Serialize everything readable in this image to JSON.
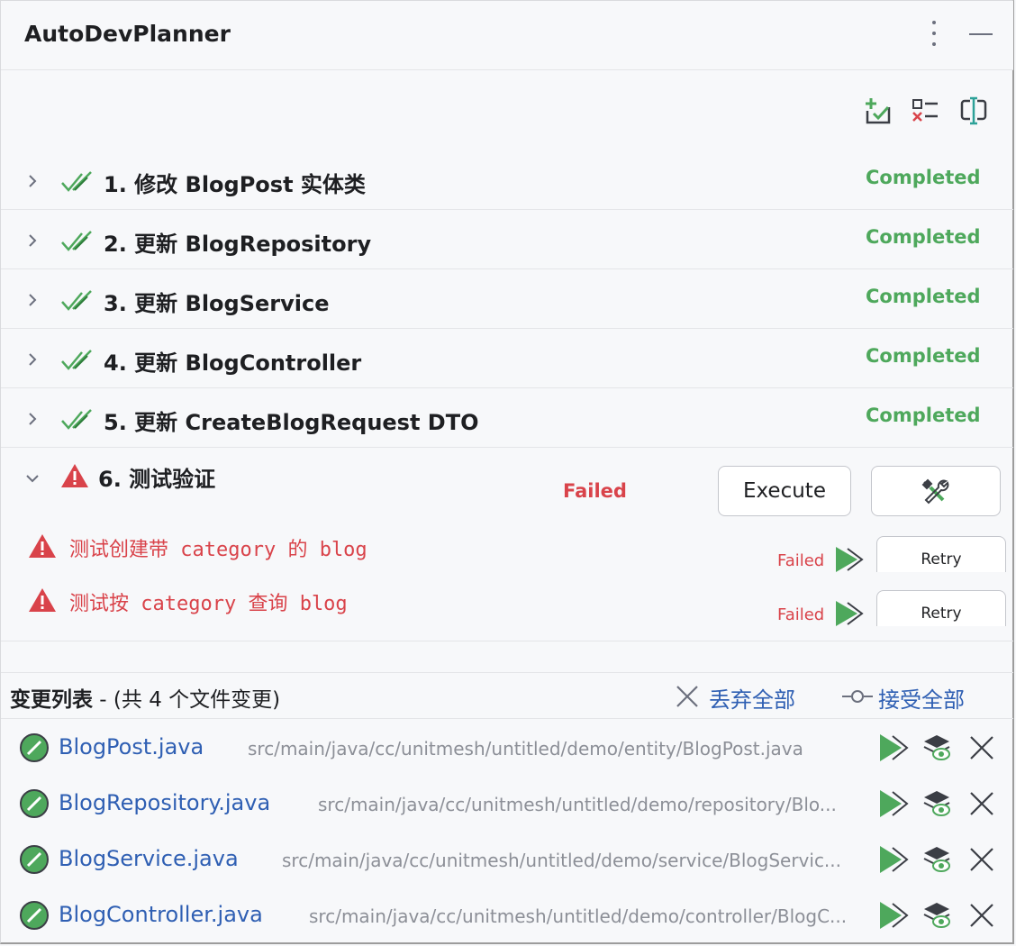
{
  "window": {
    "title": "AutoDevPlanner"
  },
  "toolbar": {
    "icons": [
      "add-task-icon",
      "checklist-icon",
      "text-cursor-icon"
    ]
  },
  "tasks": [
    {
      "title": "1. 修改 BlogPost 实体类",
      "status": "Completed"
    },
    {
      "title": "2. 更新 BlogRepository",
      "status": "Completed"
    },
    {
      "title": "3. 更新 BlogService",
      "status": "Completed"
    },
    {
      "title": "4. 更新 BlogController",
      "status": "Completed"
    },
    {
      "title": "5. 更新 CreateBlogRequest DTO",
      "status": "Completed"
    }
  ],
  "failed_task": {
    "title": "6. 测试验证",
    "status": "Failed",
    "execute_label": "Execute",
    "subtasks": [
      {
        "title": "测试创建带 category 的 blog",
        "status": "Failed",
        "retry_label": "Retry"
      },
      {
        "title": "测试按 category 查询 blog",
        "status": "Failed",
        "retry_label": "Retry"
      }
    ]
  },
  "changes": {
    "title": "变更列表",
    "count_text": " - (共 4 个文件变更)",
    "discard_all": "丢弃全部",
    "accept_all": "接受全部",
    "files": [
      {
        "name": "BlogPost.java",
        "path": "src/main/java/cc/unitmesh/untitled/demo/entity/BlogPost.java"
      },
      {
        "name": "BlogRepository.java",
        "path": "src/main/java/cc/unitmesh/untitled/demo/repository/Blo..."
      },
      {
        "name": "BlogService.java",
        "path": "src/main/java/cc/unitmesh/untitled/demo/service/BlogServic..."
      },
      {
        "name": "BlogController.java",
        "path": "src/main/java/cc/unitmesh/untitled/demo/controller/BlogC..."
      }
    ]
  },
  "colors": {
    "completed": "#4ea85c",
    "failed": "#d9434a",
    "link": "#2f5fb3",
    "path": "#8c8f97"
  }
}
